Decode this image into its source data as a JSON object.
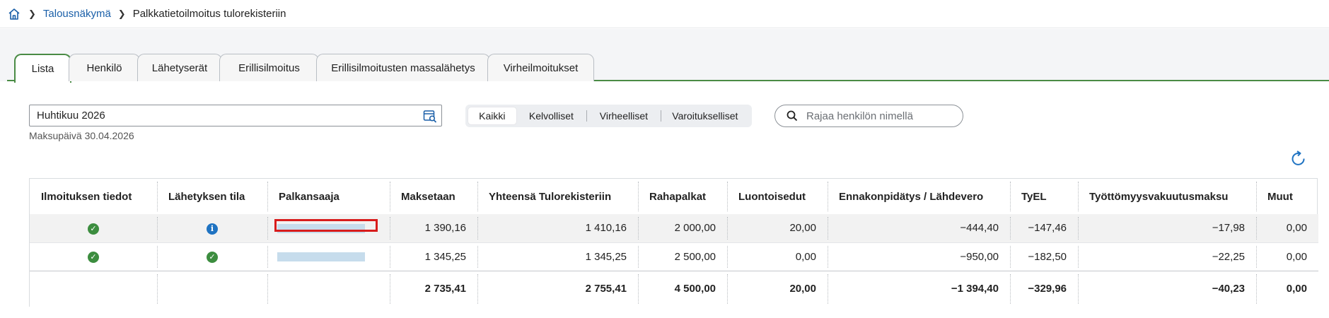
{
  "breadcrumb": {
    "home_icon": "home-icon",
    "link": "Talousnäkymä",
    "current": "Palkkatietoilmoitus tulorekisteriin"
  },
  "tabs": [
    "Lista",
    "Henkilö",
    "Lähetyserät",
    "Erillisilmoitus",
    "Erillisilmoitusten massalähetys",
    "Virheilmoitukset"
  ],
  "active_tab": "Lista",
  "period": {
    "value": "Huhtikuu 2026",
    "icon": "calendar-search-icon"
  },
  "pay_date": "Maksupäivä 30.04.2026",
  "filters": {
    "options": [
      "Kaikki",
      "Kelvolliset",
      "Virheelliset",
      "Varoitukselliset"
    ],
    "selected": "Kaikki"
  },
  "search": {
    "placeholder": "Rajaa henkilön nimellä",
    "icon": "search-icon"
  },
  "refresh_icon": "refresh-icon",
  "colors": {
    "accent": "#4a8b45",
    "link": "#1a5fa8",
    "success": "#3c8d3f",
    "info": "#1f73c2",
    "highlight": "#d81c1c"
  },
  "table": {
    "headers": [
      "Ilmoituksen tiedot",
      "Lähetyksen tila",
      "Palkansaaja",
      "Maksetaan",
      "Yhteensä Tulorekisteriin",
      "Rahapalkat",
      "Luontoisedut",
      "Ennakonpidätys / Lähdevero",
      "TyEL",
      "Työttömyysvakuutusmaksu",
      "Muut"
    ],
    "rows": [
      {
        "status_icon": "check-circle-icon",
        "send_icon": "info-circle-icon",
        "recipient": "",
        "values": [
          "1 390,16",
          "1 410,16",
          "2 000,00",
          "20,00",
          "−444,40",
          "−147,46",
          "−17,98",
          "0,00"
        ]
      },
      {
        "status_icon": "check-circle-icon",
        "send_icon": "check-circle-icon",
        "recipient": "",
        "values": [
          "1 345,25",
          "1 345,25",
          "2 500,00",
          "0,00",
          "−950,00",
          "−182,50",
          "−22,25",
          "0,00"
        ]
      }
    ],
    "totals": [
      "2 735,41",
      "2 755,41",
      "4 500,00",
      "20,00",
      "−1 394,40",
      "−329,96",
      "−40,23",
      "0,00"
    ]
  }
}
